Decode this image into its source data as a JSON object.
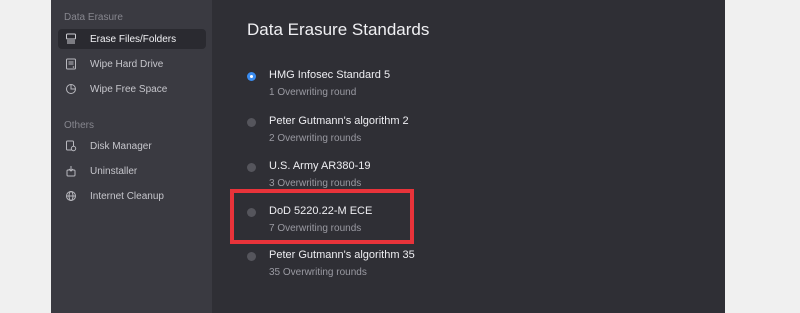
{
  "sidebar": {
    "section1_title": "Data Erasure",
    "items": [
      {
        "label": "Erase Files/Folders",
        "icon": "shredder-icon"
      },
      {
        "label": "Wipe Hard Drive",
        "icon": "drive-icon"
      },
      {
        "label": "Wipe Free Space",
        "icon": "pie-chart-icon"
      }
    ],
    "section2_title": "Others",
    "others": [
      {
        "label": "Disk Manager",
        "icon": "disk-manager-icon"
      },
      {
        "label": "Uninstaller",
        "icon": "uninstall-icon"
      },
      {
        "label": "Internet Cleanup",
        "icon": "globe-icon"
      }
    ]
  },
  "main": {
    "title": "Data Erasure Standards",
    "options": [
      {
        "name": "HMG Infosec Standard 5",
        "rounds": "1 Overwriting round",
        "selected": true
      },
      {
        "name": "Peter Gutmann's algorithm 2",
        "rounds": "2 Overwriting rounds",
        "selected": false
      },
      {
        "name": "U.S. Army AR380-19",
        "rounds": "3 Overwriting rounds",
        "selected": false
      },
      {
        "name": "DoD 5220.22-M ECE",
        "rounds": "7 Overwriting rounds",
        "selected": false
      },
      {
        "name": "Peter Gutmann's algorithm 35",
        "rounds": "35 Overwriting rounds",
        "selected": false
      }
    ]
  },
  "colors": {
    "accent": "#3a8cf0",
    "highlight": "#e8333a",
    "sidebar_bg": "#3a3a41",
    "main_bg": "#2f2f35"
  }
}
